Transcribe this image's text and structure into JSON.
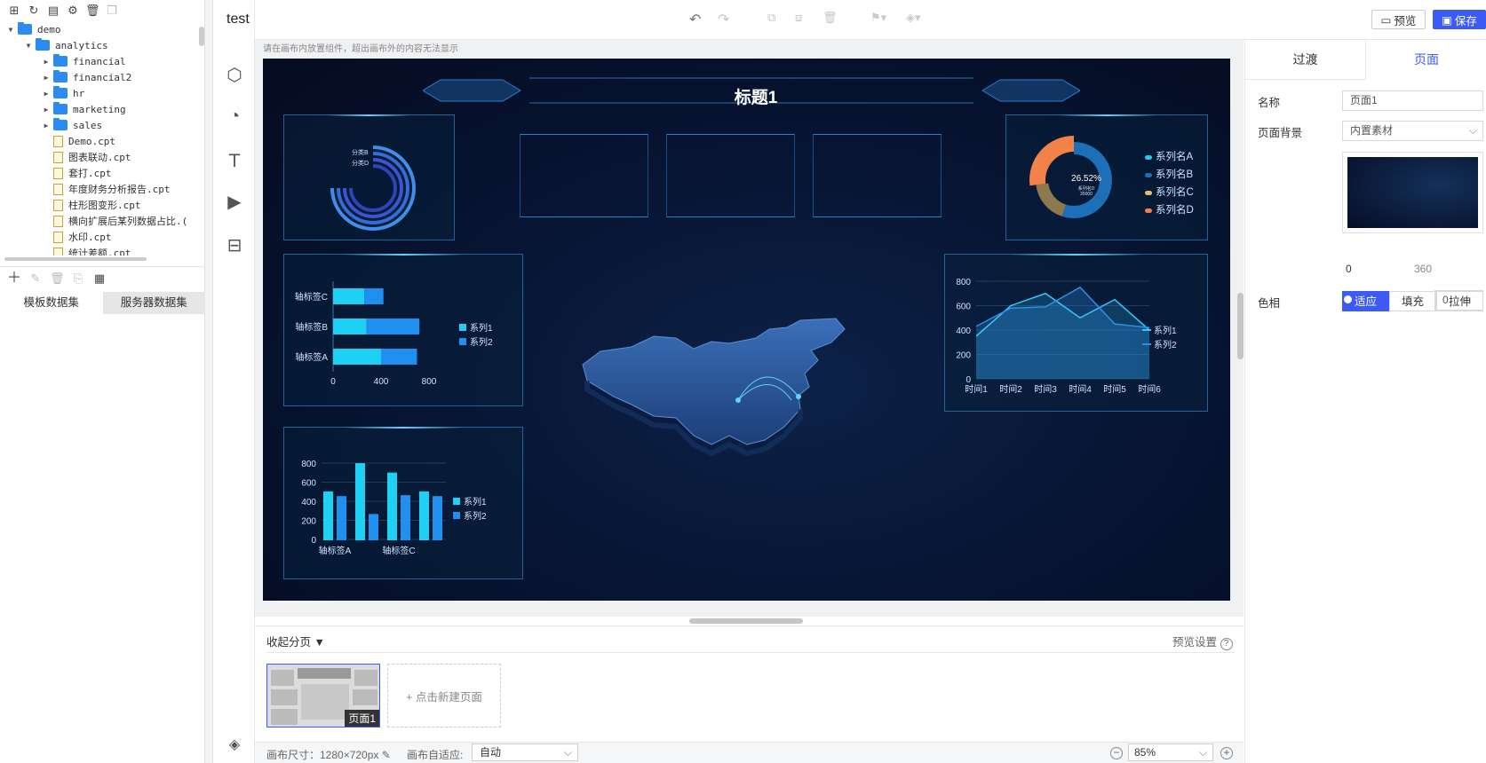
{
  "header": {
    "title": "test",
    "preview_label": "预览",
    "save_label": "保存"
  },
  "tree": {
    "items": [
      {
        "label": "demo",
        "type": "folder",
        "level": 0,
        "expanded": true
      },
      {
        "label": "analytics",
        "type": "folder",
        "level": 1,
        "expanded": true
      },
      {
        "label": "financial",
        "type": "folder",
        "level": 2
      },
      {
        "label": "financial2",
        "type": "folder",
        "level": 2
      },
      {
        "label": "hr",
        "type": "folder",
        "level": 2
      },
      {
        "label": "marketing",
        "type": "folder",
        "level": 2
      },
      {
        "label": "sales",
        "type": "folder",
        "level": 2
      },
      {
        "label": "Demo.cpt",
        "type": "file",
        "level": 2
      },
      {
        "label": "图表联动.cpt",
        "type": "file",
        "level": 2
      },
      {
        "label": "套打.cpt",
        "type": "file",
        "level": 2
      },
      {
        "label": "年度财务分析报告.cpt",
        "type": "file",
        "level": 2
      },
      {
        "label": "柱形图变形.cpt",
        "type": "file",
        "level": 2
      },
      {
        "label": "横向扩展后某列数据占比.(",
        "type": "file",
        "level": 2
      },
      {
        "label": "水印.cpt",
        "type": "file",
        "level": 2
      },
      {
        "label": "统计差额.cpt",
        "type": "file",
        "level": 2
      }
    ]
  },
  "datasets": {
    "tab1": "模板数据集",
    "tab2": "服务器数据集"
  },
  "canvas": {
    "hint": "请在画布内放置组件，超出画布外的内容无法显示",
    "title": "标题1"
  },
  "charts": {
    "ring": {
      "labels": [
        "分类B",
        "分类D"
      ]
    },
    "hbar": {
      "categories": [
        "轴标签C",
        "轴标签B",
        "轴标签A"
      ],
      "values": [
        [
          260,
          160
        ],
        [
          280,
          440
        ],
        [
          400,
          300
        ]
      ],
      "ticks": [
        "0",
        "400",
        "800"
      ],
      "legend": [
        "系列1",
        "系列2"
      ]
    },
    "vbar": {
      "categories": [
        "轴标签A",
        "轴标签C"
      ],
      "yticks": [
        "800",
        "600",
        "400",
        "200",
        "0"
      ],
      "legend": [
        "系列1",
        "系列2"
      ],
      "s1": [
        520,
        820,
        720,
        520
      ],
      "s2": [
        470,
        280,
        480,
        470
      ]
    },
    "pie": {
      "center_value": "26.52%",
      "center_sub1": "系列名D",
      "center_sub2": "35000",
      "legend": [
        "系列名A",
        "系列名B",
        "系列名C",
        "系列名D"
      ],
      "colors": [
        "#29c7f5",
        "#1d6fb8",
        "#e2c06b",
        "#f2824a"
      ]
    },
    "line": {
      "x": [
        "时间1",
        "时间2",
        "时间3",
        "时间4",
        "时间5",
        "时间6"
      ],
      "yticks": [
        "800",
        "600",
        "400",
        "200",
        "0"
      ],
      "s1": [
        350,
        600,
        700,
        500,
        650,
        400
      ],
      "s2": [
        430,
        580,
        590,
        750,
        450,
        420
      ],
      "legend": [
        "系列1",
        "系列2"
      ]
    }
  },
  "pages": {
    "collapse_label": "收起分页",
    "preview_settings": "预览设置",
    "thumb_label": "页面1",
    "new_page": "+ 点击新建页面"
  },
  "status": {
    "canvas_size": "画布尺寸：1280×720px",
    "auto_fit_label": "画布自适应:",
    "auto_fit_value": "自动",
    "zoom": "85%"
  },
  "right": {
    "tab_transition": "过渡",
    "tab_page": "页面",
    "name_label": "名称",
    "name_value": "页面1",
    "bg_label": "页面背景",
    "bg_value": "内置素材",
    "fit": [
      "适应",
      "填充",
      "拉伸"
    ],
    "hue_label": "色相",
    "hue_min": "0",
    "hue_max": "360",
    "hue_value": "0"
  }
}
